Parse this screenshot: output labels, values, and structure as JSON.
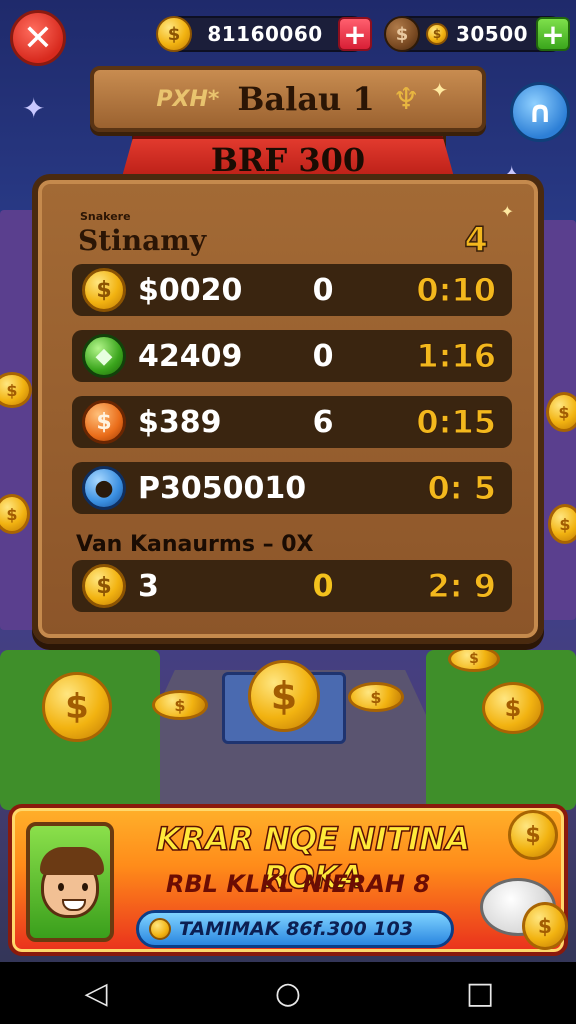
{
  "hud": {
    "close_icon": "close-icon",
    "currency_primary": {
      "icon": "dollar-coin-icon",
      "icon_glyph": "$",
      "value": "81160060",
      "add_label": "+"
    },
    "currency_secondary": {
      "icon": "bronze-coin-icon",
      "icon_glyph": "$",
      "small_icon_glyph": "$",
      "value": "30500",
      "add_label": "+"
    },
    "side_button_icon": "magnet-icon"
  },
  "title_sign": {
    "left_text": "PXH*",
    "main": "Balau 1"
  },
  "ribbon": {
    "text": "BRF 300"
  },
  "board": {
    "subtitle": "Snakere",
    "title": "Stinamy",
    "rank": "4",
    "rows": [
      {
        "icon": "gold-coin-icon",
        "icon_glyph": "$",
        "name": "$0020",
        "score": "0",
        "time": "0:10"
      },
      {
        "icon": "green-gem-icon",
        "icon_glyph": "◆",
        "name": "42409",
        "score": "0",
        "time": "1:16"
      },
      {
        "icon": "orange-coin-icon",
        "icon_glyph": "$",
        "name": "$389",
        "score": "6",
        "time": "0:15"
      },
      {
        "icon": "avatar-icon",
        "icon_glyph": "●",
        "name": "P3050010",
        "score": "",
        "time": "0: 5"
      }
    ],
    "section_label": "Van Kanaurms – 0X",
    "player_row": {
      "icon": "gold-coin-icon",
      "icon_glyph": "$",
      "name": "3",
      "score": "0",
      "time": "2: 9"
    }
  },
  "banner": {
    "title": "KRAR NQE NITINA ROKA",
    "subtitle": "RBL KLKL NIERAH 8",
    "pill_text": "TAMIMAK 86f.300 103"
  },
  "navbar": {
    "back": "◁",
    "home": "○",
    "recents": "□"
  }
}
